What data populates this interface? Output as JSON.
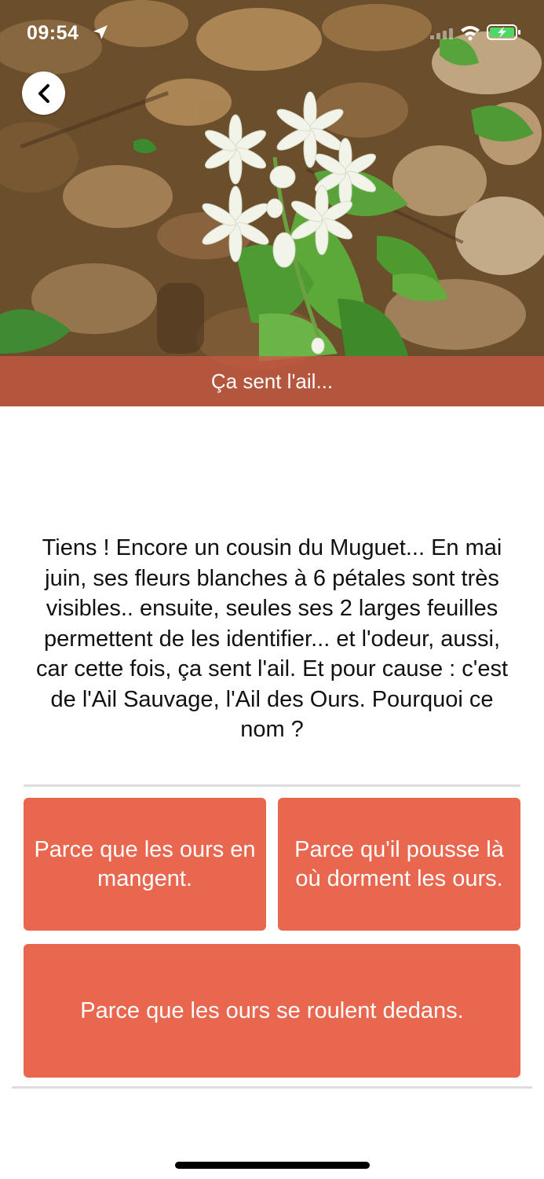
{
  "status_bar": {
    "time": "09:54"
  },
  "hero": {
    "caption": "Ça sent l'ail..."
  },
  "question": {
    "text": "Tiens ! Encore un cousin du Muguet... En mai juin, ses fleurs blanches à 6 pétales sont très visibles.. ensuite, seules ses 2 larges feuilles permettent de les identifier... et l'odeur, aussi, car cette fois, ça sent l'ail. Et pour cause : c'est de l'Ail Sauvage, l'Ail des Ours. Pourquoi ce nom ?"
  },
  "answers": [
    {
      "label": "Parce que les ours en mangent."
    },
    {
      "label": "Parce qu'il pousse là où dorment les ours."
    },
    {
      "label": "Parce que les ours se roulent dedans."
    }
  ],
  "colors": {
    "answer_bg": "#e8674e",
    "caption_bg": "#c95842",
    "divider": "#dddddd"
  },
  "icons": {
    "back": "chevron-left-icon",
    "location": "location-arrow-icon",
    "signal": "cellular-signal-icon",
    "wifi": "wifi-icon",
    "battery": "battery-charging-icon"
  }
}
